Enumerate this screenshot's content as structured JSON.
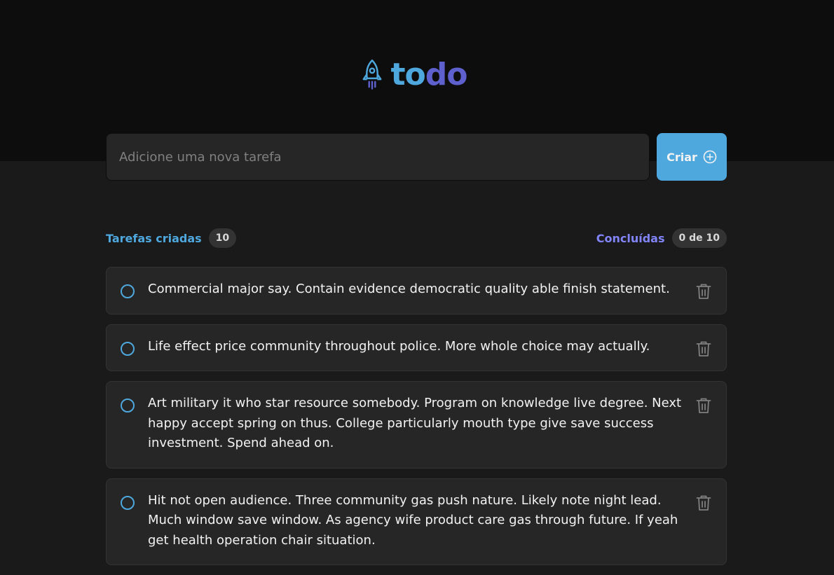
{
  "header": {
    "logo_to": "to",
    "logo_do": "do"
  },
  "new_task": {
    "placeholder": "Adicione uma nova tarefa",
    "value": "",
    "create_label": "Criar"
  },
  "counters": {
    "created_label": "Tarefas criadas",
    "created_count": "10",
    "done_label": "Concluídas",
    "done_count": "0 de 10"
  },
  "tasks": [
    {
      "text": "Commercial major say. Contain evidence democratic quality able finish statement.",
      "done": false
    },
    {
      "text": "Life effect price community throughout police. More whole choice may actually.",
      "done": false
    },
    {
      "text": "Art military it who star resource somebody. Program on knowledge live degree. Next happy accept spring on thus. College particularly mouth type give save success investment. Spend ahead on.",
      "done": false
    },
    {
      "text": "Hit not open audience. Three community gas push nature. Likely note night lead. Much window save window. As agency wife product care gas through future. If yeah get health operation chair situation.",
      "done": false
    }
  ],
  "colors": {
    "blue": "#4ea8de",
    "purple": "#5e60ce",
    "purple_light": "#8284fa",
    "bg": "#1a1a1a",
    "header_bg": "#0d0d0d",
    "card_bg": "#262626"
  }
}
